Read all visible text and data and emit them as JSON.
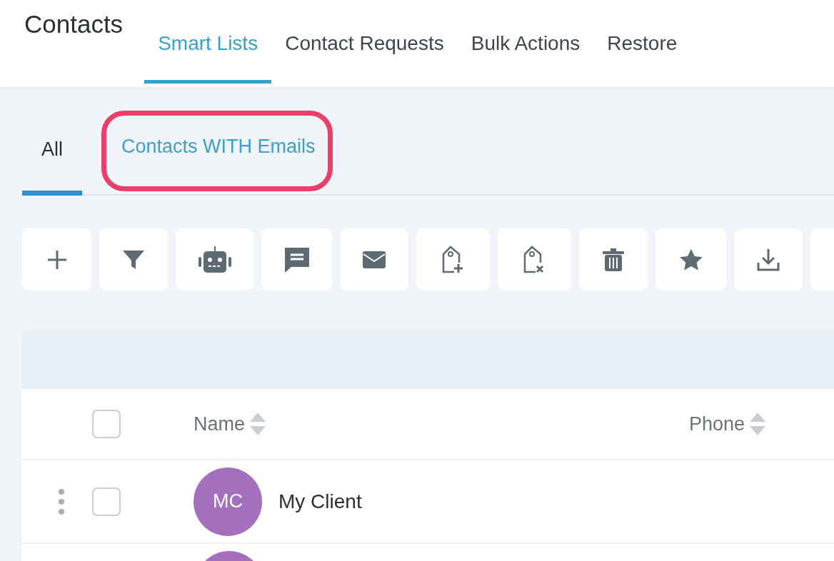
{
  "header": {
    "title": "Contacts"
  },
  "tabs": [
    {
      "label": "Smart Lists",
      "selected": true
    },
    {
      "label": "Contact Requests",
      "selected": false
    },
    {
      "label": "Bulk Actions",
      "selected": false
    },
    {
      "label": "Restore",
      "selected": false
    }
  ],
  "smart_lists": [
    {
      "label": "All",
      "selected": true,
      "highlighted": false
    },
    {
      "label": "Contacts WITH Emails",
      "selected": false,
      "highlighted": true
    }
  ],
  "table": {
    "select_all": {
      "checked": false
    },
    "columns": [
      "Name",
      "Phone"
    ],
    "rows": [
      {
        "initials": "MC",
        "name": "My Client",
        "checked": false,
        "color": "#a46fbd"
      }
    ]
  }
}
